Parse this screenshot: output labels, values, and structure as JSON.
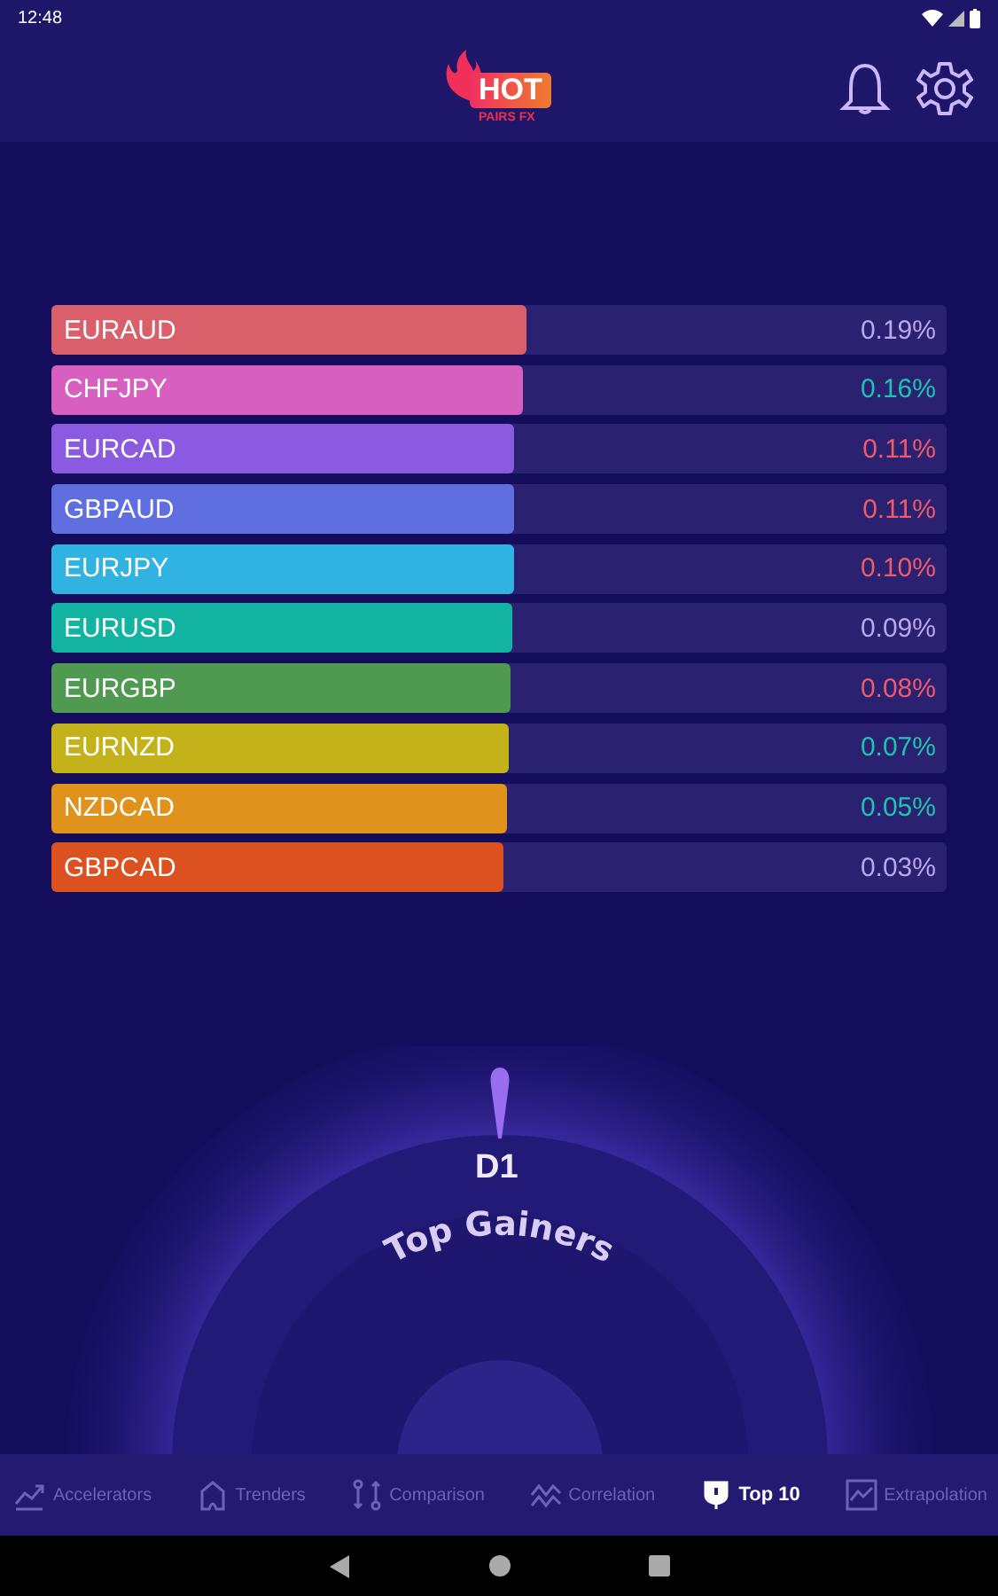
{
  "status_bar": {
    "time": "12:48"
  },
  "app_bar": {
    "logo": {
      "word": "HOT",
      "tagline": "PAIRS FX"
    }
  },
  "pairs": [
    {
      "name": "EURAUD",
      "color": "#d9606a",
      "level": 0.53,
      "change": {
        "text": "0.19%",
        "color": "#b7a8f0"
      }
    },
    {
      "name": "CHFJPY",
      "color": "#d65fbf",
      "level": 0.527,
      "change": {
        "text": "0.16%",
        "color": "#1fc4b0"
      }
    },
    {
      "name": "EURCAD",
      "color": "#8a5be0",
      "level": 0.517,
      "change": {
        "text": "0.11%",
        "color": "#f05a6a"
      }
    },
    {
      "name": "GBPAUD",
      "color": "#5f6fe0",
      "level": 0.517,
      "change": {
        "text": "0.11%",
        "color": "#f05a6a"
      }
    },
    {
      "name": "EURJPY",
      "color": "#31b3e2",
      "level": 0.517,
      "change": {
        "text": "0.10%",
        "color": "#f05a6a"
      }
    },
    {
      "name": "EURUSD",
      "color": "#12b3a0",
      "level": 0.515,
      "change": {
        "text": "0.09%",
        "color": "#b7a8f0"
      }
    },
    {
      "name": "EURGBP",
      "color": "#4f9a50",
      "level": 0.513,
      "change": {
        "text": "0.08%",
        "color": "#f05a6a"
      }
    },
    {
      "name": "EURNZD",
      "color": "#c4b21a",
      "level": 0.51,
      "change": {
        "text": "0.07%",
        "color": "#1fc4b0"
      }
    },
    {
      "name": "NZDCAD",
      "color": "#e0931c",
      "level": 0.509,
      "change": {
        "text": "0.05%",
        "color": "#1fc4b0"
      }
    },
    {
      "name": "GBPCAD",
      "color": "#db5120",
      "level": 0.505,
      "change": {
        "text": "0.03%",
        "color": "#b7a8f0"
      }
    }
  ],
  "dial": {
    "timeframe": "D1",
    "mode": "Top Gainers"
  },
  "tabs": [
    {
      "label": "Accelerators",
      "kind": "accelerators",
      "selected": false
    },
    {
      "label": "Trenders",
      "kind": "trenders",
      "selected": false
    },
    {
      "label": "Comparison",
      "kind": "comparison",
      "selected": false
    },
    {
      "label": "Correlation",
      "kind": "correlation",
      "selected": false
    },
    {
      "label": "Top 10",
      "kind": "top",
      "selected": true
    },
    {
      "label": "Extrapolation",
      "kind": "extrapolation",
      "selected": false
    }
  ]
}
